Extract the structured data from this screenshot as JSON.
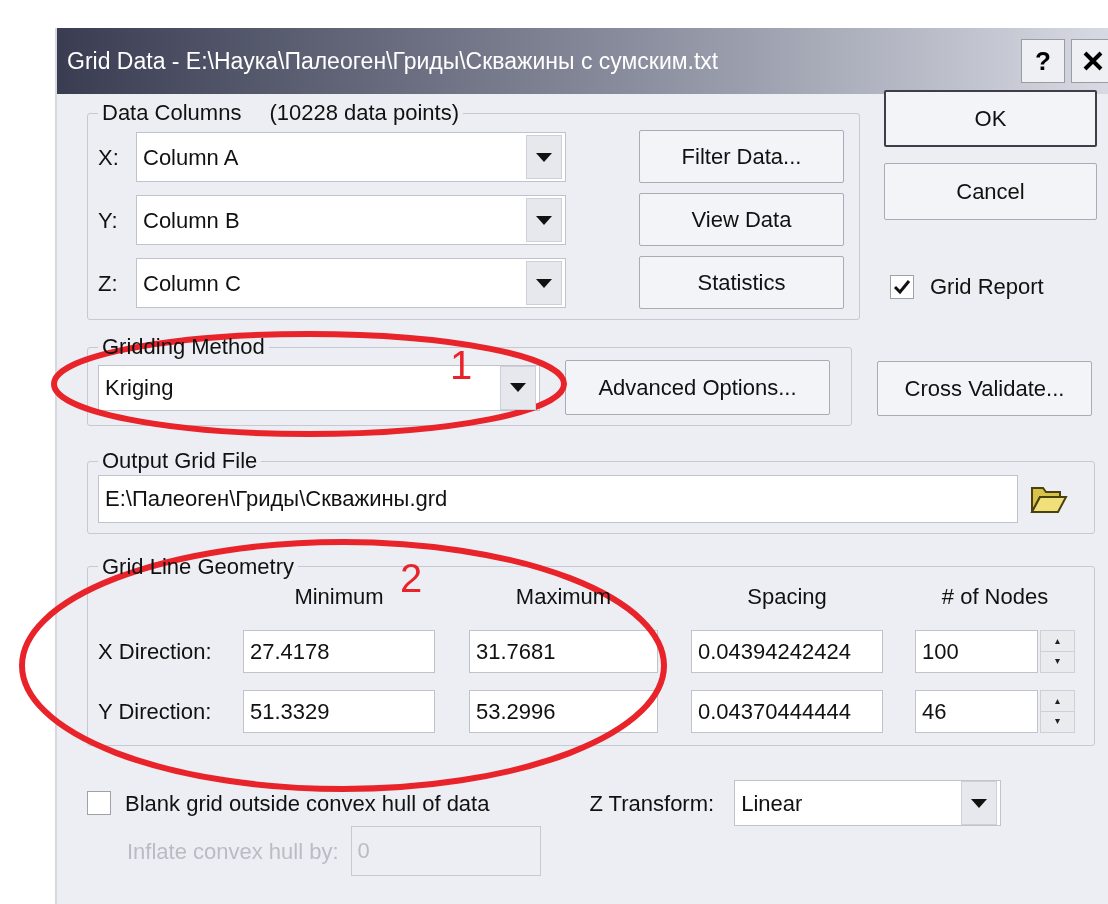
{
  "window": {
    "title": "Grid Data - E:\\Наука\\Палеоген\\Гриды\\Скважины с сумским.txt",
    "help_button": "?"
  },
  "data_columns": {
    "legend": "Data Columns",
    "count": "(10228 data points)",
    "rows": [
      {
        "label": "X:",
        "value": "Column A"
      },
      {
        "label": "Y:",
        "value": "Column B"
      },
      {
        "label": "Z:",
        "value": "Column C"
      }
    ]
  },
  "data_buttons": [
    "Filter Data...",
    "View Data",
    "Statistics"
  ],
  "dialog_buttons": [
    {
      "label": "OK",
      "default": true
    },
    {
      "label": "Cancel",
      "default": false
    }
  ],
  "grid_report": {
    "label": "Grid Report",
    "checked": true
  },
  "gridding_method": {
    "legend": "Gridding Method",
    "value": "Kriging",
    "options_button": "Advanced Options..."
  },
  "cross_validate_button": "Cross Validate...",
  "output_grid_file": {
    "legend": "Output Grid File",
    "value": "E:\\Палеоген\\Гриды\\Скважины.grd"
  },
  "grid_line_geometry": {
    "legend": "Grid Line Geometry",
    "columns": [
      "Minimum",
      "Maximum",
      "Spacing",
      "# of Nodes"
    ],
    "rows": [
      {
        "label": "X Direction:",
        "minimum": "27.4178",
        "maximum": "31.7681",
        "spacing": "0.04394242424",
        "nodes": "100"
      },
      {
        "label": "Y Direction:",
        "minimum": "51.3329",
        "maximum": "53.2996",
        "spacing": "0.04370444444",
        "nodes": "46"
      }
    ]
  },
  "blank_hull": {
    "label": "Blank grid outside convex hull of data",
    "checked": false
  },
  "inflate": {
    "label": "Inflate convex hull by:",
    "value": "0",
    "disabled": true
  },
  "z_transform": {
    "label": "Z Transform:",
    "value": "Linear"
  },
  "annotations": [
    {
      "label": "1"
    },
    {
      "label": "2"
    }
  ]
}
